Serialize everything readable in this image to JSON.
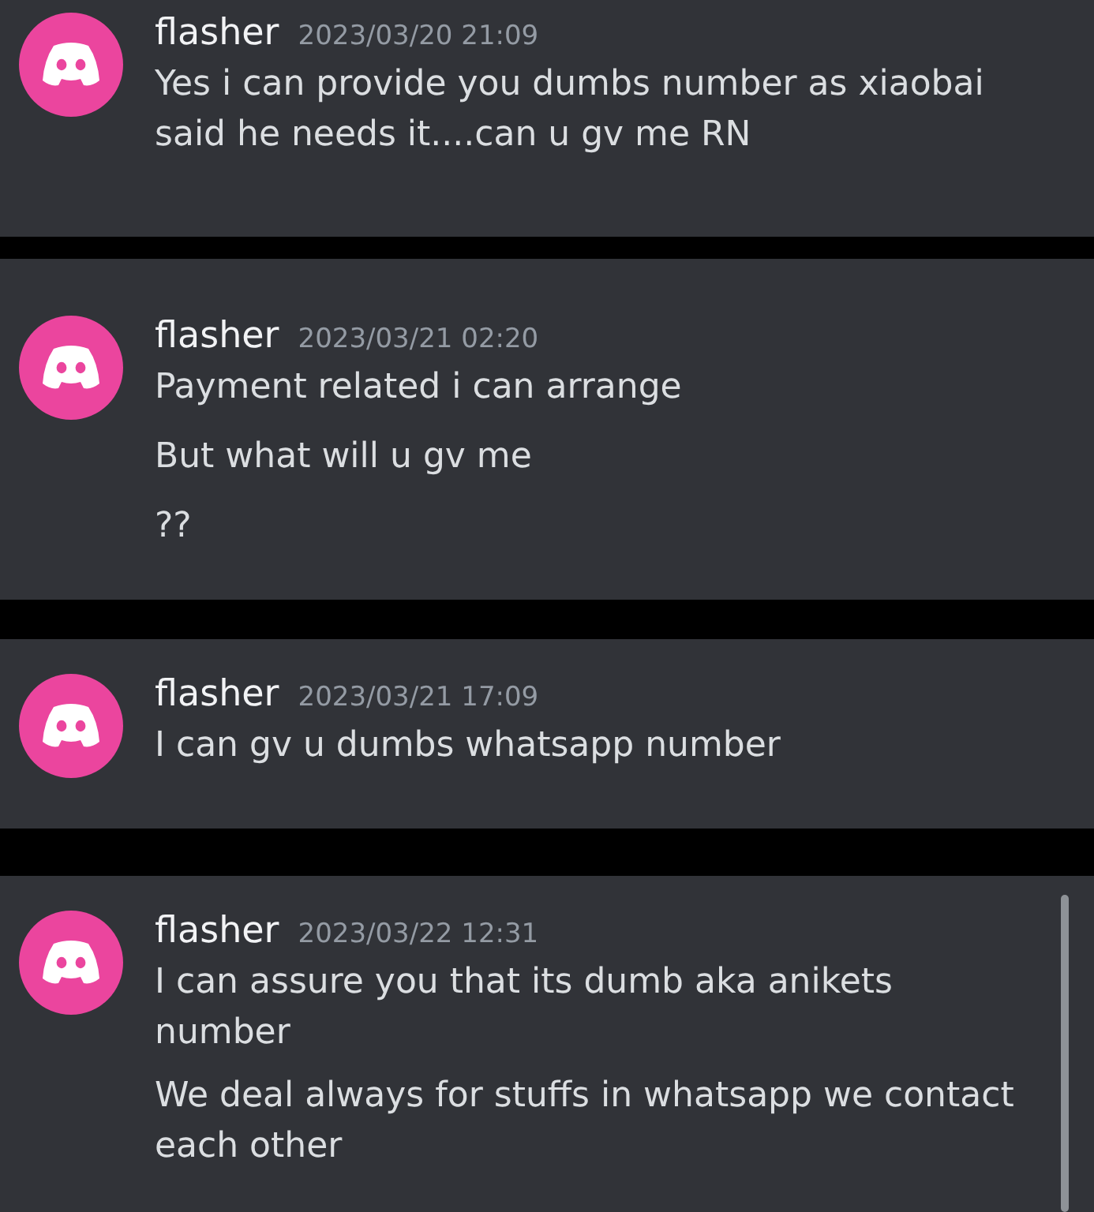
{
  "cards": [
    {
      "author": "flasher",
      "timestamp": "2023/03/20 21:09",
      "messages": [
        "Yes i can provide you dumbs number as xiaobai said he needs it....can u gv me RN"
      ],
      "scrollbar": false
    },
    {
      "author": "flasher",
      "timestamp": "2023/03/21 02:20",
      "messages": [
        "Payment related i can arrange",
        "But what will u gv me",
        "??"
      ],
      "scrollbar": false
    },
    {
      "author": "flasher",
      "timestamp": "2023/03/21 17:09",
      "messages": [
        "I can gv u dumbs whatsapp number"
      ],
      "scrollbar": false
    },
    {
      "author": "flasher",
      "timestamp": "2023/03/22 12:31",
      "messages": [
        "I can assure you that its dumb aka anikets number",
        "We deal always for stuffs in whatsapp we contact each other"
      ],
      "scrollbar": true
    }
  ]
}
